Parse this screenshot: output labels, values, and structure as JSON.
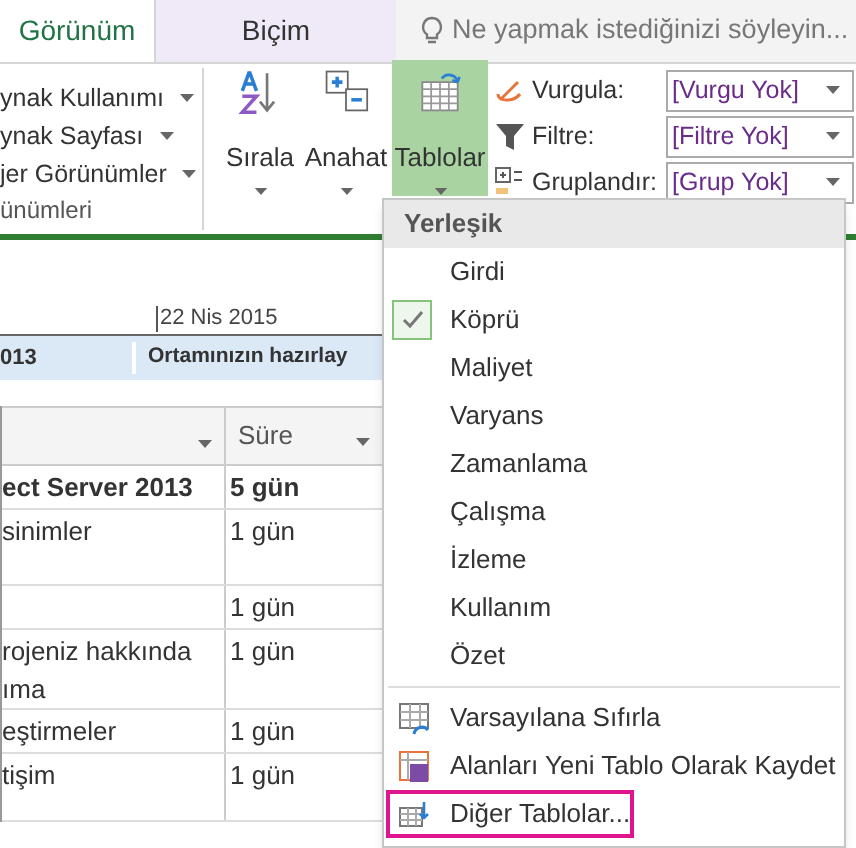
{
  "tabs": [
    {
      "label": "Görünüm",
      "selected": true,
      "kind": "tab"
    },
    {
      "label": "Biçim",
      "selected": false,
      "kind": "contextual"
    }
  ],
  "search": {
    "placeholder": "Ne yapmak istediğinizi söyleyin..."
  },
  "ribbon": {
    "view_items": [
      "ynak Kullanımı",
      "ynak Sayfası",
      "jer Görünümler"
    ],
    "group_label": "ünümleri",
    "buttons": [
      {
        "label": "Sırala",
        "kind": "sort",
        "selected": false
      },
      {
        "label": "Anahat",
        "kind": "outline",
        "selected": false
      },
      {
        "label": "Tablolar",
        "kind": "tables",
        "selected": true
      }
    ],
    "filters": [
      {
        "label": "Vurgula:",
        "kind": "highlight",
        "value": "[Vurgu Yok]"
      },
      {
        "label": "Filtre:",
        "kind": "filter",
        "value": "[Filtre Yok]"
      },
      {
        "label": "Gruplandır:",
        "kind": "group",
        "value": "[Grup Yok]"
      }
    ]
  },
  "timeline": {
    "date": "22 Nis 2015",
    "bar_texts": [
      "013",
      "Ortamınızın hazırlay"
    ]
  },
  "grid": {
    "duration_header": "Süre",
    "rows": [
      {
        "name": "ect Server 2013",
        "duration": "5 gün",
        "bold": true
      },
      {
        "name": "sinimler",
        "duration": "1 gün",
        "bold": false
      },
      {
        "duration": "1 gün",
        "bold": false
      },
      {
        "name": "rojeniz hakkında\nıma",
        "duration": "1 gün",
        "bold": false
      },
      {
        "name": "eştirmeler",
        "duration": "1 gün",
        "bold": false
      },
      {
        "name": "tişim",
        "duration": "1 gün",
        "bold": false
      }
    ]
  },
  "menu": {
    "header": "Yerleşik",
    "items": [
      {
        "label": "Girdi",
        "checked": false
      },
      {
        "label": "Köprü",
        "checked": true
      },
      {
        "label": "Maliyet",
        "checked": false
      },
      {
        "label": "Varyans",
        "checked": false
      },
      {
        "label": "Zamanlama",
        "checked": false
      },
      {
        "label": "Çalışma",
        "checked": false
      },
      {
        "label": "İzleme",
        "checked": false
      },
      {
        "label": "Kullanım",
        "checked": false
      },
      {
        "label": "Özet",
        "checked": false
      }
    ],
    "actions": [
      {
        "label": "Varsayılana Sıfırla",
        "kind": "reset",
        "highlighted": false
      },
      {
        "label": "Alanları Yeni Tablo Olarak Kaydet",
        "kind": "save",
        "highlighted": false
      },
      {
        "label": "Diğer Tablolar...",
        "kind": "more",
        "highlighted": true
      }
    ]
  }
}
